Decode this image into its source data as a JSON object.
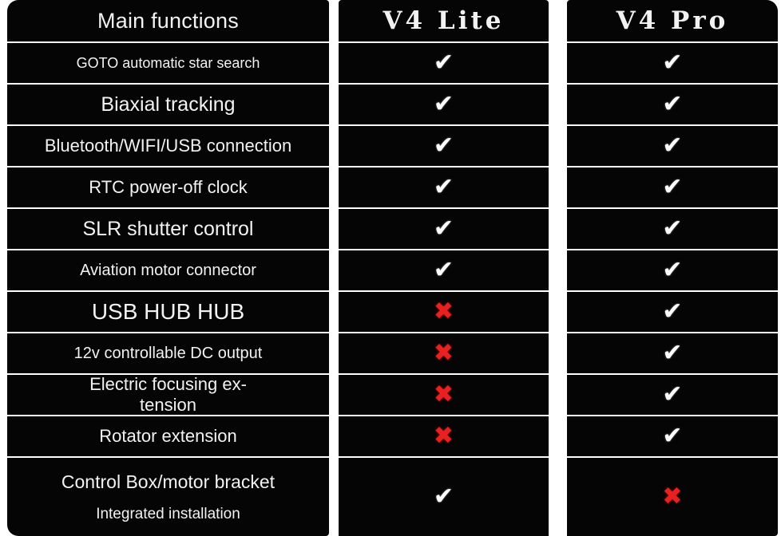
{
  "table": {
    "columns": [
      {
        "id": "features",
        "header": "Main functions"
      },
      {
        "id": "lite",
        "header": "V4 Lite"
      },
      {
        "id": "pro",
        "header": "V4 Pro"
      }
    ],
    "icons": {
      "check": "✔",
      "cross": "✖",
      "check_name": "check-icon",
      "cross_name": "cross-icon"
    },
    "colors": {
      "cell_background": "#050505",
      "page_background": "#ffffff",
      "text": "#f2f2f2",
      "check": "#ffffff",
      "cross": "#e82020"
    },
    "rows": [
      {
        "feature": "GOTO automatic star search",
        "lite": "check",
        "pro": "check"
      },
      {
        "feature": "Biaxial tracking",
        "lite": "check",
        "pro": "check"
      },
      {
        "feature": "Bluetooth/WIFI/USB connection",
        "lite": "check",
        "pro": "check"
      },
      {
        "feature": "RTC power-off clock",
        "lite": "check",
        "pro": "check"
      },
      {
        "feature": "SLR shutter control",
        "lite": "check",
        "pro": "check"
      },
      {
        "feature": "Aviation motor connector",
        "lite": "check",
        "pro": "check"
      },
      {
        "feature": "USB HUB HUB",
        "lite": "cross",
        "pro": "check"
      },
      {
        "feature": "12v controllable DC output",
        "lite": "cross",
        "pro": "check"
      },
      {
        "feature_line_a": "Electric focusing ex-",
        "feature_line_b": "tension",
        "lite": "cross",
        "pro": "check"
      },
      {
        "feature": "Rotator extension",
        "lite": "cross",
        "pro": "check"
      },
      {
        "feature_line_a": "Control Box/motor bracket",
        "feature_line_b": "Integrated installation",
        "lite": "check",
        "pro": "cross"
      }
    ]
  }
}
